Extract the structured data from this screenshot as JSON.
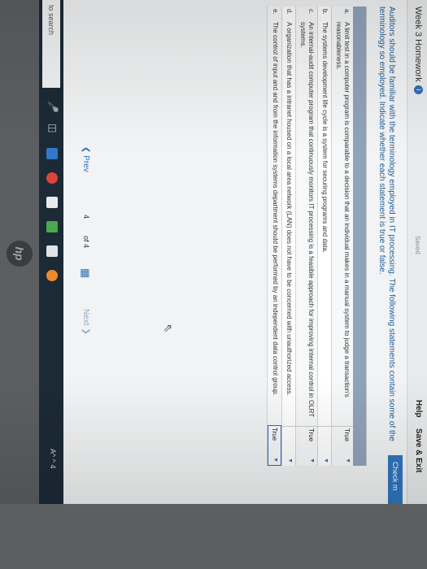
{
  "header": {
    "title": "Week 3 Homework",
    "info_icon": "i",
    "status": "Saved",
    "help_label": "Help",
    "save_exit_label": "Save & Exit",
    "check_label": "Check m"
  },
  "prompt": "Auditors should be familiar with the terminology employed in IT processing. The following statements contain some of the terminology so employed. Indicate whether each statement is true or false.",
  "table": {
    "rows": [
      {
        "letter": "a.",
        "statement": "A limit test in a computer program is comparable to a decision that an individual makes in a manual system to judge a transaction's reasonableness.",
        "answer": "True"
      },
      {
        "letter": "b.",
        "statement": "The systems development life cycle is a system for securing programs and data.",
        "answer": ""
      },
      {
        "letter": "c.",
        "statement": "An internal-audit computer program that continuously monitors IT processing is a feasible approach for improving internal control in OLRT systems.",
        "answer": "True"
      },
      {
        "letter": "d.",
        "statement": "A organization that has a intranet housed on a local area network (LAN) does not have to be concerned with unauthorized access.",
        "answer": ""
      },
      {
        "letter": "e.",
        "statement": "The control of input and and from the information systems department should be performed by an independent data control group.",
        "answer": "True"
      }
    ]
  },
  "pager": {
    "prev_label": "Prev",
    "current": "4",
    "of_total": "of 4",
    "next_label": "Next"
  },
  "taskbar": {
    "search_label": "to search",
    "tray_text": "A^ ^ 4"
  },
  "colors": {
    "accent": "#2f76bf",
    "table_header": "#8fa3ba",
    "taskbar": "#1c2a36"
  }
}
